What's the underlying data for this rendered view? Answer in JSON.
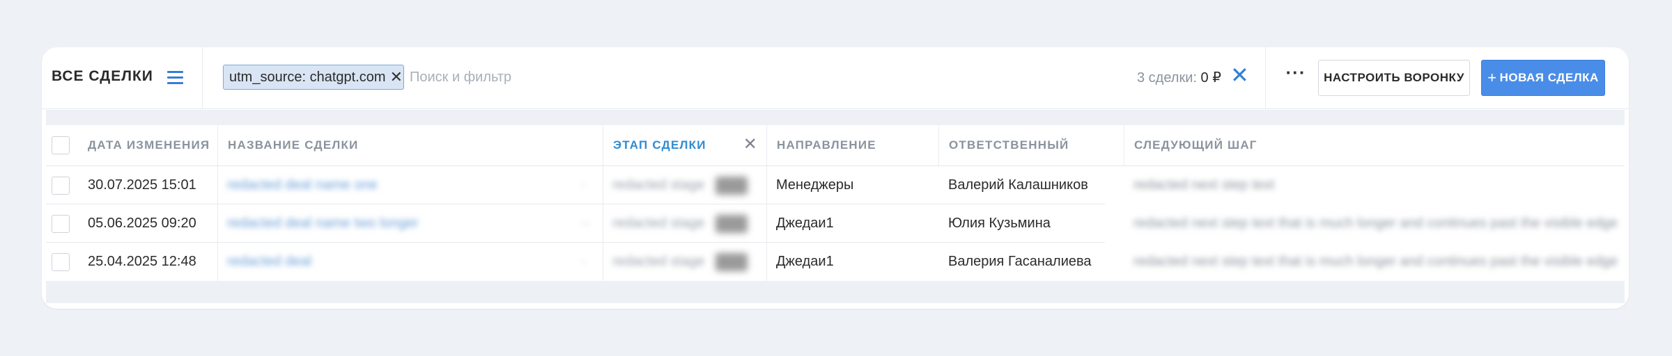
{
  "toolbar": {
    "title": "ВСЕ СДЕЛКИ",
    "menu_icon": "hamburger-menu-icon",
    "filter_chip": {
      "label": "utm_source: chatgpt.com",
      "close": "✕"
    },
    "search_placeholder": "Поиск и фильтр",
    "deal_count": "3 сделки:",
    "deal_sum": "0 ₽",
    "clear_label": "✕",
    "more_label": "···",
    "configure_funnel_label": "НАСТРОИТЬ ВОРОНКУ",
    "new_deal_plus": "+",
    "new_deal_label": "НОВАЯ СДЕЛКА",
    "accent_color": "#4a8de8"
  },
  "table": {
    "columns": {
      "changed": "ДАТА ИЗМЕНЕНИЯ",
      "name": "НАЗВАНИЕ СДЕЛКИ",
      "stage": "ЭТАП СДЕЛКИ",
      "stage_close": "✕",
      "direction": "НАПРАВЛЕНИЕ",
      "responsible": "ОТВЕТСТВЕННЫЙ",
      "next_step": "СЛЕДУЮЩИЙ ШАГ"
    },
    "rows": [
      {
        "date": "30.07.2025 15:01",
        "name": "redacted deal name one",
        "mark": "·",
        "stage": "redacted stage",
        "direction": "Менеджеры",
        "responsible": "Валерий Калашников",
        "next_step": "redacted next step text"
      },
      {
        "date": "05.06.2025 09:20",
        "name": "redacted deal name two longer",
        "mark": "··",
        "stage": "redacted stage",
        "direction": "Джедаи1",
        "responsible": "Юлия Кузьмина",
        "next_step": "redacted next step text that is much longer and continues past the visible edge"
      },
      {
        "date": "25.04.2025 12:48",
        "name": "redacted deal",
        "mark": "·",
        "stage": "redacted stage",
        "direction": "Джедаи1",
        "responsible": "Валерия Гасаналиева",
        "next_step": "redacted next step text that is much longer and continues past the visible edge"
      }
    ]
  }
}
